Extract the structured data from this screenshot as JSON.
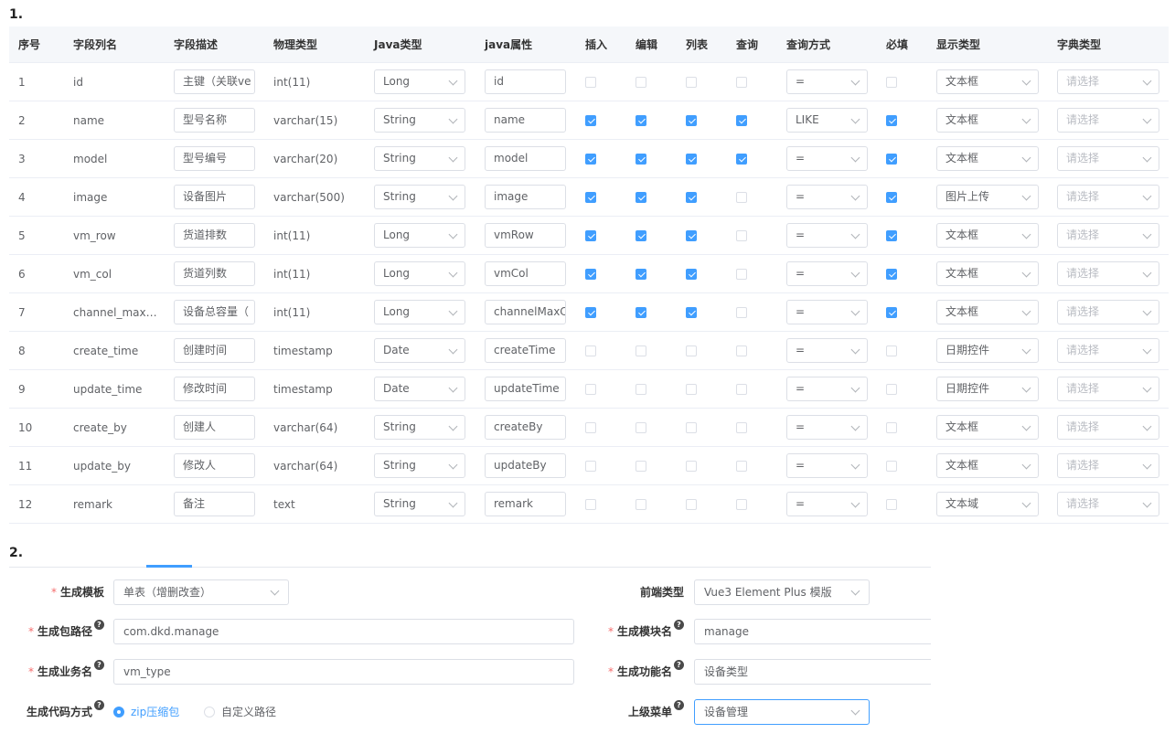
{
  "section1_label": "1.",
  "section2_label": "2.",
  "table": {
    "headers": [
      "序号",
      "字段列名",
      "字段描述",
      "物理类型",
      "Java类型",
      "java属性",
      "插入",
      "编辑",
      "列表",
      "查询",
      "查询方式",
      "必填",
      "显示类型",
      "字典类型"
    ],
    "dict_placeholder": "请选择",
    "rows": [
      {
        "no": "1",
        "col": "id",
        "desc": "主键（关联ve",
        "phys": "int(11)",
        "jtype": "Long",
        "jprop": "id",
        "ins": false,
        "edit": false,
        "list": false,
        "query": false,
        "qtype": "=",
        "req": false,
        "html": "文本框"
      },
      {
        "no": "2",
        "col": "name",
        "desc": "型号名称",
        "phys": "varchar(15)",
        "jtype": "String",
        "jprop": "name",
        "ins": true,
        "edit": true,
        "list": true,
        "query": true,
        "qtype": "LIKE",
        "req": true,
        "html": "文本框"
      },
      {
        "no": "3",
        "col": "model",
        "desc": "型号编号",
        "phys": "varchar(20)",
        "jtype": "String",
        "jprop": "model",
        "ins": true,
        "edit": true,
        "list": true,
        "query": true,
        "qtype": "=",
        "req": true,
        "html": "文本框"
      },
      {
        "no": "4",
        "col": "image",
        "desc": "设备图片",
        "phys": "varchar(500)",
        "jtype": "String",
        "jprop": "image",
        "ins": true,
        "edit": true,
        "list": true,
        "query": false,
        "qtype": "=",
        "req": true,
        "html": "图片上传"
      },
      {
        "no": "5",
        "col": "vm_row",
        "desc": "货道排数",
        "phys": "int(11)",
        "jtype": "Long",
        "jprop": "vmRow",
        "ins": true,
        "edit": true,
        "list": true,
        "query": false,
        "qtype": "=",
        "req": true,
        "html": "文本框"
      },
      {
        "no": "6",
        "col": "vm_col",
        "desc": "货道列数",
        "phys": "int(11)",
        "jtype": "Long",
        "jprop": "vmCol",
        "ins": true,
        "edit": true,
        "list": true,
        "query": false,
        "qtype": "=",
        "req": true,
        "html": "文本框"
      },
      {
        "no": "7",
        "col": "channel_max…",
        "desc": "设备总容量（",
        "phys": "int(11)",
        "jtype": "Long",
        "jprop": "channelMaxC",
        "ins": true,
        "edit": true,
        "list": true,
        "query": false,
        "qtype": "=",
        "req": true,
        "html": "文本框"
      },
      {
        "no": "8",
        "col": "create_time",
        "desc": "创建时间",
        "phys": "timestamp",
        "jtype": "Date",
        "jprop": "createTime",
        "ins": false,
        "edit": false,
        "list": false,
        "query": false,
        "qtype": "=",
        "req": false,
        "html": "日期控件"
      },
      {
        "no": "9",
        "col": "update_time",
        "desc": "修改时间",
        "phys": "timestamp",
        "jtype": "Date",
        "jprop": "updateTime",
        "ins": false,
        "edit": false,
        "list": false,
        "query": false,
        "qtype": "=",
        "req": false,
        "html": "日期控件"
      },
      {
        "no": "10",
        "col": "create_by",
        "desc": "创建人",
        "phys": "varchar(64)",
        "jtype": "String",
        "jprop": "createBy",
        "ins": false,
        "edit": false,
        "list": false,
        "query": false,
        "qtype": "=",
        "req": false,
        "html": "文本框"
      },
      {
        "no": "11",
        "col": "update_by",
        "desc": "修改人",
        "phys": "varchar(64)",
        "jtype": "String",
        "jprop": "updateBy",
        "ins": false,
        "edit": false,
        "list": false,
        "query": false,
        "qtype": "=",
        "req": false,
        "html": "文本框"
      },
      {
        "no": "12",
        "col": "remark",
        "desc": "备注",
        "phys": "text",
        "jtype": "String",
        "jprop": "remark",
        "ins": false,
        "edit": false,
        "list": false,
        "query": false,
        "qtype": "=",
        "req": false,
        "html": "文本域"
      }
    ]
  },
  "form": {
    "tpl_label": "生成模板",
    "tpl_value": "单表（增删改查）",
    "frontend_label": "前端类型",
    "frontend_value": "Vue3 Element Plus 模版",
    "pkg_label": "生成包路径",
    "pkg_value": "com.dkd.manage",
    "module_label": "生成模块名",
    "module_value": "manage",
    "biz_label": "生成业务名",
    "biz_value": "vm_type",
    "func_label": "生成功能名",
    "func_value": "设备类型",
    "gentype_label": "生成代码方式",
    "radio_zip": "zip压缩包",
    "radio_custom": "自定义路径",
    "parent_menu_label": "上级菜单",
    "parent_menu_value": "设备管理",
    "required_mark": "*",
    "help_mark": "?"
  },
  "colors": {
    "accent": "#409eff",
    "required": "#f56c6c",
    "border": "#dcdfe6",
    "header_bg": "#f5f7fa"
  }
}
